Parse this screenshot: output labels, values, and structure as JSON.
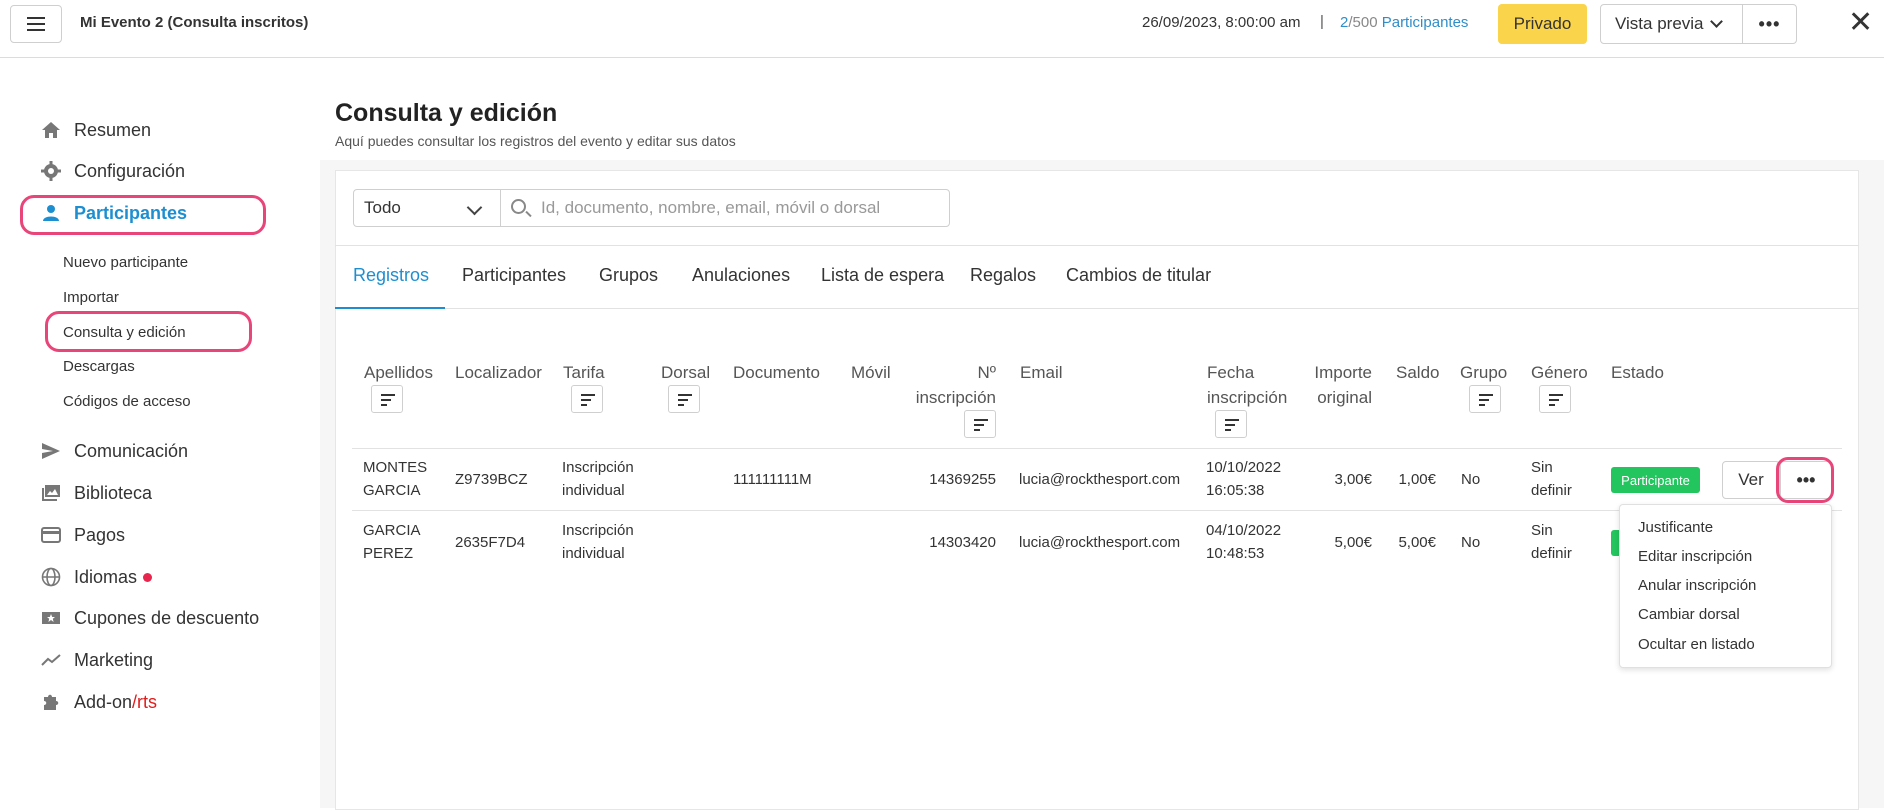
{
  "header": {
    "event_title": "Mi Evento 2 (Consulta inscritos)",
    "event_date": "26/09/2023, 8:00:00 am",
    "separator": "|",
    "count_current": "2",
    "count_total": "/500",
    "count_label": "Participantes",
    "privado_label": "Privado",
    "vista_label": "Vista previa",
    "more_label": "•••",
    "close_label": "✕"
  },
  "sidebar": {
    "items": [
      {
        "label": "Resumen",
        "icon": "home-icon"
      },
      {
        "label": "Configuración",
        "icon": "gear-icon"
      },
      {
        "label": "Participantes",
        "icon": "person-icon"
      },
      {
        "label": "Comunicación",
        "icon": "send-icon"
      },
      {
        "label": "Biblioteca",
        "icon": "photo-library-icon"
      },
      {
        "label": "Pagos",
        "icon": "credit-card-icon"
      },
      {
        "label": "Idiomas",
        "icon": "globe-icon"
      },
      {
        "label": "Cupones de descuento",
        "icon": "coupon-icon"
      },
      {
        "label": "Marketing",
        "icon": "trend-icon"
      },
      {
        "label": "Add-on",
        "label_suffix": "/rts",
        "icon": "puzzle-icon"
      }
    ],
    "sub_items": [
      {
        "label": "Nuevo participante"
      },
      {
        "label": "Importar"
      },
      {
        "label": "Consulta y edición"
      },
      {
        "label": "Descargas"
      },
      {
        "label": "Códigos de acceso"
      }
    ]
  },
  "main": {
    "title": "Consulta y edición",
    "subtitle": "Aquí puedes consultar los registros del evento y editar sus datos",
    "filter_value": "Todo",
    "search_placeholder": "Id, documento, nombre, email, móvil o dorsal",
    "tabs": [
      {
        "label": "Registros"
      },
      {
        "label": "Participantes"
      },
      {
        "label": "Grupos"
      },
      {
        "label": "Anulaciones"
      },
      {
        "label": "Lista de espera"
      },
      {
        "label": "Regalos"
      },
      {
        "label": "Cambios de titular"
      }
    ],
    "columns": {
      "apellidos": "Apellidos",
      "localizador": "Localizador",
      "tarifa": "Tarifa",
      "dorsal": "Dorsal",
      "documento": "Documento",
      "movil": "Móvil",
      "inscripcion_1": "Nº",
      "inscripcion_2": "inscripción",
      "email": "Email",
      "fecha_1": "Fecha",
      "fecha_2": "inscripción",
      "importe_1": "Importe",
      "importe_2": "original",
      "saldo": "Saldo",
      "grupo": "Grupo",
      "genero": "Género",
      "estado": "Estado"
    },
    "rows": [
      {
        "apellidos_1": "MONTES",
        "apellidos_2": "GARCIA",
        "localizador": "Z9739BCZ",
        "tarifa_1": "Inscripción",
        "tarifa_2": "individual",
        "dorsal": "",
        "documento": "111111111M",
        "movil": "",
        "inscripcion": "14369255",
        "email": "lucia@rockthesport.com",
        "fecha_1": "10/10/2022",
        "fecha_2": "16:05:38",
        "importe": "3,00€",
        "saldo": "1,00€",
        "grupo": "No",
        "genero_1": "Sin",
        "genero_2": "definir",
        "estado": "Participante"
      },
      {
        "apellidos_1": "GARCIA",
        "apellidos_2": "PEREZ",
        "localizador": "2635F7D4",
        "tarifa_1": "Inscripción",
        "tarifa_2": "individual",
        "dorsal": "",
        "documento": "",
        "movil": "",
        "inscripcion": "14303420",
        "email": "lucia@rockthesport.com",
        "fecha_1": "04/10/2022",
        "fecha_2": "10:48:53",
        "importe": "5,00€",
        "saldo": "5,00€",
        "grupo": "No",
        "genero_1": "Sin",
        "genero_2": "definir",
        "estado": ""
      }
    ],
    "ver_label": "Ver",
    "dots_label": "•••",
    "dropdown": [
      {
        "label": "Justificante"
      },
      {
        "label": "Editar inscripción"
      },
      {
        "label": "Anular inscripción"
      },
      {
        "label": "Cambiar dorsal"
      },
      {
        "label": "Ocultar en listado"
      }
    ]
  },
  "colors": {
    "accent": "#1d8fd0",
    "highlight": "#e8457a",
    "privado": "#fad44a",
    "status_green": "#22c55e"
  }
}
